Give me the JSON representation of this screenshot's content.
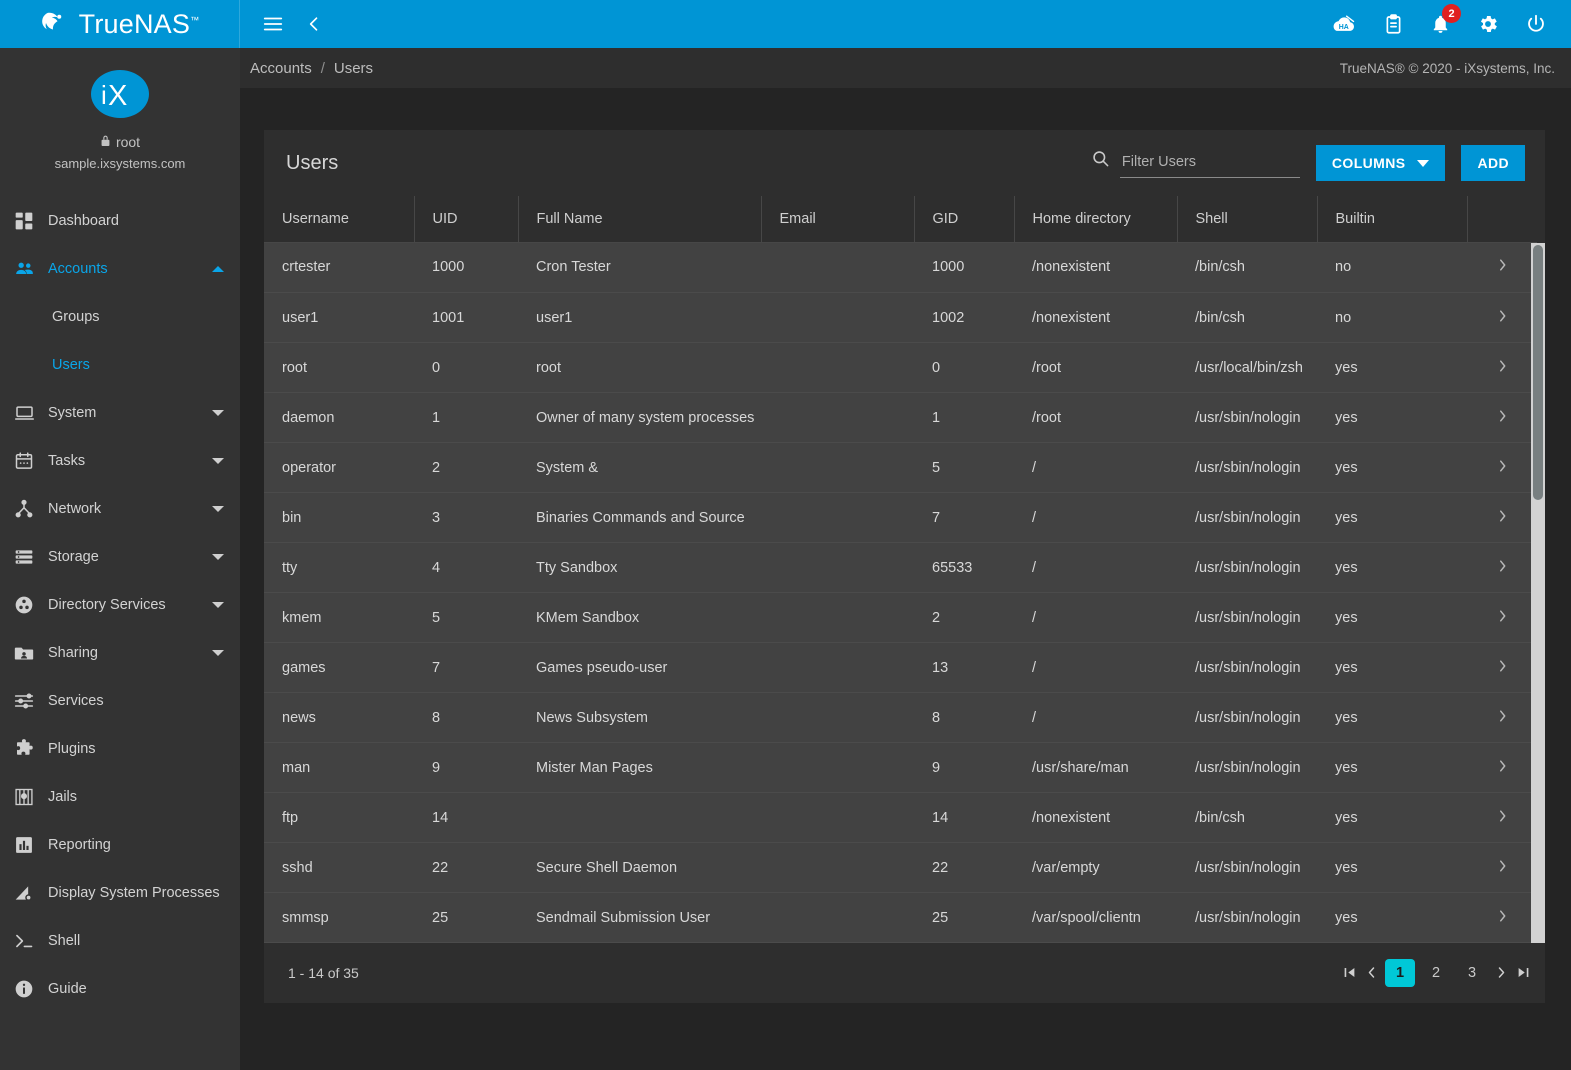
{
  "topbar": {
    "brand": "TrueNAS",
    "brand_tm": "™",
    "menu_icon": "hamburger-icon",
    "back_icon": "chevron-left-icon",
    "accent": "#0095d5",
    "icons": [
      {
        "name": "ha-status-icon",
        "label": "HA"
      },
      {
        "name": "clipboard-icon",
        "label": ""
      },
      {
        "name": "notifications-bell-icon",
        "label": ""
      },
      {
        "name": "settings-gear-icon",
        "label": ""
      },
      {
        "name": "power-icon",
        "label": ""
      }
    ],
    "notification_count": "2",
    "badge_color": "#e02020"
  },
  "sidebar": {
    "logo_text": "iX",
    "user": "root",
    "lock_icon": "lock-icon",
    "hostname": "sample.ixsystems.com",
    "items": [
      {
        "label": "Dashboard",
        "icon": "dashboard-icon",
        "expandable": false,
        "active": false
      },
      {
        "label": "Accounts",
        "icon": "accounts-people-icon",
        "expandable": true,
        "expanded": true,
        "active": true
      },
      {
        "label": "Groups",
        "icon": "",
        "sub": true,
        "active": false
      },
      {
        "label": "Users",
        "icon": "",
        "sub": true,
        "active": true
      },
      {
        "label": "System",
        "icon": "system-monitor-icon",
        "expandable": true,
        "expanded": false,
        "active": false
      },
      {
        "label": "Tasks",
        "icon": "calendar-tasks-icon",
        "expandable": true,
        "expanded": false,
        "active": false
      },
      {
        "label": "Network",
        "icon": "network-icon",
        "expandable": true,
        "expanded": false,
        "active": false
      },
      {
        "label": "Storage",
        "icon": "storage-icon",
        "expandable": true,
        "expanded": false,
        "active": false
      },
      {
        "label": "Directory Services",
        "icon": "directory-services-icon",
        "expandable": true,
        "expanded": false,
        "active": false
      },
      {
        "label": "Sharing",
        "icon": "sharing-folder-icon",
        "expandable": true,
        "expanded": false,
        "active": false
      },
      {
        "label": "Services",
        "icon": "services-sliders-icon",
        "expandable": false,
        "active": false
      },
      {
        "label": "Plugins",
        "icon": "plugins-puzzle-icon",
        "expandable": false,
        "active": false
      },
      {
        "label": "Jails",
        "icon": "jails-icon",
        "expandable": false,
        "active": false
      },
      {
        "label": "Reporting",
        "icon": "reporting-chart-icon",
        "expandable": false,
        "active": false
      },
      {
        "label": "Display System Processes",
        "icon": "system-processes-icon",
        "expandable": false,
        "active": false
      },
      {
        "label": "Shell",
        "icon": "shell-prompt-icon",
        "expandable": false,
        "active": false
      },
      {
        "label": "Guide",
        "icon": "guide-info-icon",
        "expandable": false,
        "active": false
      }
    ]
  },
  "breadcrumb": {
    "parent": "Accounts",
    "separator": "/",
    "current": "Users"
  },
  "copyright": "TrueNAS® © 2020 - iXsystems, Inc.",
  "card": {
    "title": "Users",
    "search_placeholder": "Filter Users",
    "search_value": "",
    "search_icon": "search-icon",
    "columns_button": "COLUMNS",
    "columns_caret_icon": "chevron-down-icon",
    "add_button": "ADD"
  },
  "table": {
    "columns": [
      "Username",
      "UID",
      "Full Name",
      "Email",
      "GID",
      "Home directory",
      "Shell",
      "Builtin",
      ""
    ],
    "rows": [
      {
        "username": "crtester",
        "uid": "1000",
        "full_name": "Cron Tester",
        "email": "",
        "gid": "1000",
        "home": "/nonexistent",
        "shell": "/bin/csh",
        "builtin": "no"
      },
      {
        "username": "user1",
        "uid": "1001",
        "full_name": "user1",
        "email": "",
        "gid": "1002",
        "home": "/nonexistent",
        "shell": "/bin/csh",
        "builtin": "no"
      },
      {
        "username": "root",
        "uid": "0",
        "full_name": "root",
        "email": "",
        "gid": "0",
        "home": "/root",
        "shell": "/usr/local/bin/zsh",
        "builtin": "yes"
      },
      {
        "username": "daemon",
        "uid": "1",
        "full_name": "Owner of many system processes",
        "email": "",
        "gid": "1",
        "home": "/root",
        "shell": "/usr/sbin/nologin",
        "builtin": "yes"
      },
      {
        "username": "operator",
        "uid": "2",
        "full_name": "System &",
        "email": "",
        "gid": "5",
        "home": "/",
        "shell": "/usr/sbin/nologin",
        "builtin": "yes"
      },
      {
        "username": "bin",
        "uid": "3",
        "full_name": "Binaries Commands and Source",
        "email": "",
        "gid": "7",
        "home": "/",
        "shell": "/usr/sbin/nologin",
        "builtin": "yes"
      },
      {
        "username": "tty",
        "uid": "4",
        "full_name": "Tty Sandbox",
        "email": "",
        "gid": "65533",
        "home": "/",
        "shell": "/usr/sbin/nologin",
        "builtin": "yes"
      },
      {
        "username": "kmem",
        "uid": "5",
        "full_name": "KMem Sandbox",
        "email": "",
        "gid": "2",
        "home": "/",
        "shell": "/usr/sbin/nologin",
        "builtin": "yes"
      },
      {
        "username": "games",
        "uid": "7",
        "full_name": "Games pseudo-user",
        "email": "",
        "gid": "13",
        "home": "/",
        "shell": "/usr/sbin/nologin",
        "builtin": "yes"
      },
      {
        "username": "news",
        "uid": "8",
        "full_name": "News Subsystem",
        "email": "",
        "gid": "8",
        "home": "/",
        "shell": "/usr/sbin/nologin",
        "builtin": "yes"
      },
      {
        "username": "man",
        "uid": "9",
        "full_name": "Mister Man Pages",
        "email": "",
        "gid": "9",
        "home": "/usr/share/man",
        "shell": "/usr/sbin/nologin",
        "builtin": "yes"
      },
      {
        "username": "ftp",
        "uid": "14",
        "full_name": "",
        "email": "",
        "gid": "14",
        "home": "/nonexistent",
        "shell": "/bin/csh",
        "builtin": "yes"
      },
      {
        "username": "sshd",
        "uid": "22",
        "full_name": "Secure Shell Daemon",
        "email": "",
        "gid": "22",
        "home": "/var/empty",
        "shell": "/usr/sbin/nologin",
        "builtin": "yes"
      },
      {
        "username": "smmsp",
        "uid": "25",
        "full_name": "Sendmail Submission User",
        "email": "",
        "gid": "25",
        "home": "/var/spool/clientn",
        "shell": "/usr/sbin/nologin",
        "builtin": "yes"
      }
    ],
    "row_expand_icon": "chevron-right-icon"
  },
  "footer": {
    "range": "1 - 14 of 35",
    "first_icon": "first-page-icon",
    "prev_icon": "previous-page-icon",
    "pages": [
      "1",
      "2",
      "3"
    ],
    "active_page": "1",
    "next_icon": "next-page-icon",
    "last_icon": "last-page-icon",
    "active_color": "#00c8d7"
  }
}
